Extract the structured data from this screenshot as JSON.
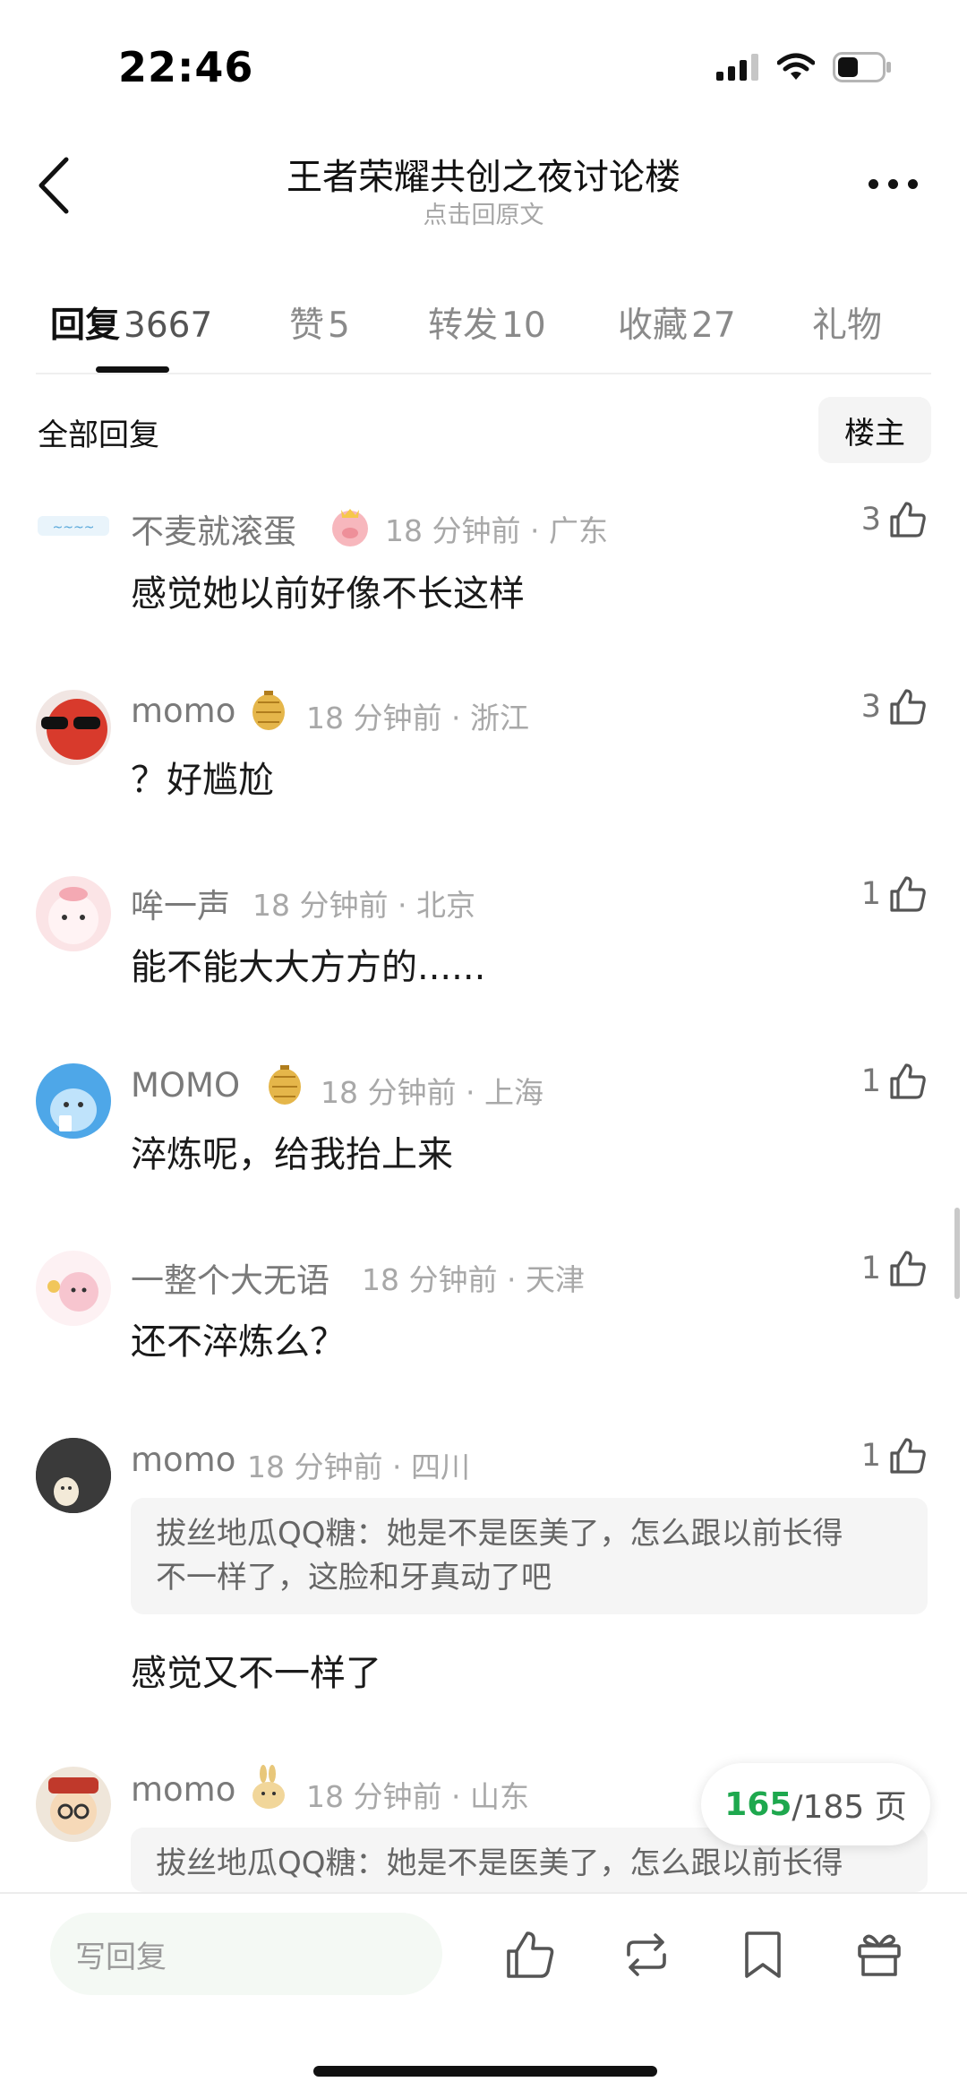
{
  "status": {
    "time": "22:46"
  },
  "header": {
    "title": "王者荣耀共创之夜讨论楼",
    "subtitle": "点击回原文"
  },
  "tabs": [
    {
      "label": "回复",
      "count": "3667"
    },
    {
      "label": "赞",
      "count": "5"
    },
    {
      "label": "转发",
      "count": "10"
    },
    {
      "label": "收藏",
      "count": "27"
    },
    {
      "label": "礼物",
      "count": ""
    }
  ],
  "section": {
    "title": "全部回复",
    "owner_button": "楼主"
  },
  "comments": [
    {
      "username": "不麦就滚蛋",
      "time": "18 分钟前",
      "location": "广东",
      "likes": "3",
      "text": "感觉她以前好像不长这样"
    },
    {
      "username": "momo",
      "time": "18 分钟前",
      "location": "浙江",
      "likes": "3",
      "text": "？好尴尬"
    },
    {
      "username": "哞一声",
      "time": "18 分钟前",
      "location": "北京",
      "likes": "1",
      "text": "能不能大大方方的......"
    },
    {
      "username": "MOMO",
      "time": "18 分钟前",
      "location": "上海",
      "likes": "1",
      "text": "淬炼呢，给我抬上来"
    },
    {
      "username": "一整个大无语",
      "time": "18 分钟前",
      "location": "天津",
      "likes": "1",
      "text": "还不淬炼么？"
    },
    {
      "username": "momo",
      "time": "18 分钟前",
      "location": "四川",
      "likes": "1",
      "quote_author": "拔丝地瓜QQ糖",
      "quote_line1": "她是不是医美了，怎么跟以前长得",
      "quote_line2": "不一样了，这脸和牙真动了吧",
      "text": "感觉又不一样了"
    },
    {
      "username": "momo",
      "time": "18 分钟前",
      "location": "山东",
      "likes": "",
      "quote_author": "拔丝地瓜QQ糖",
      "quote_line1": "她是不是医美了，怎么跟以前长得"
    }
  ],
  "pager": {
    "current": "165",
    "total": "/185 页"
  },
  "bottom": {
    "reply_placeholder": "写回复"
  },
  "icons": [
    "back-icon",
    "more-icon",
    "like-icon",
    "repost-icon",
    "bookmark-icon",
    "gift-icon",
    "signal-icon",
    "wifi-icon",
    "battery-icon"
  ],
  "colors": {
    "accent_green": "#1ea84e",
    "text_secondary": "#7a7a7a",
    "quote_bg": "#f5f5f5"
  }
}
